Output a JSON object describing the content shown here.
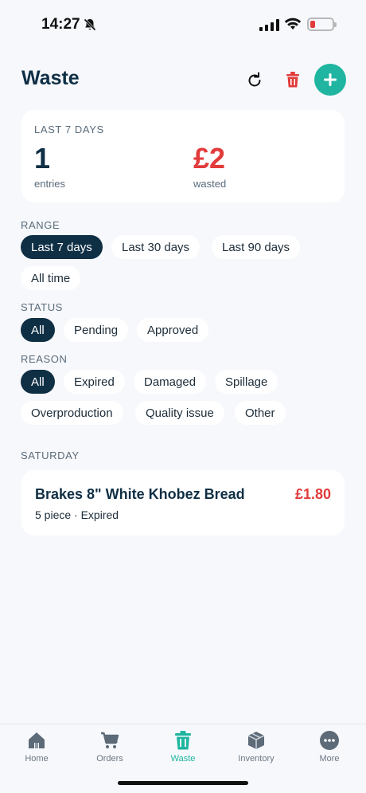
{
  "status_bar": {
    "time": "14:27"
  },
  "header": {
    "title": "Waste"
  },
  "summary": {
    "period_label": "LAST 7 DAYS",
    "entries_value": "1",
    "entries_label": "entries",
    "wasted_value": "£2",
    "wasted_label": "wasted"
  },
  "filters": {
    "range": {
      "label": "RANGE",
      "options": [
        "Last 7 days",
        "Last 30 days",
        "Last 90 days",
        "All time"
      ],
      "selected": "Last 7 days"
    },
    "status": {
      "label": "STATUS",
      "options": [
        "All",
        "Pending",
        "Approved"
      ],
      "selected": "All"
    },
    "reason": {
      "label": "REASON",
      "options": [
        "All",
        "Expired",
        "Damaged",
        "Spillage",
        "Overproduction",
        "Quality issue",
        "Other"
      ],
      "selected": "All"
    }
  },
  "groups": [
    {
      "day": "SATURDAY",
      "entries": [
        {
          "name": "Brakes 8\" White Khobez Bread",
          "amount": "£1.80",
          "meta": "5 piece · Expired"
        }
      ]
    }
  ],
  "tabs": [
    {
      "label": "Home",
      "icon": "home-icon"
    },
    {
      "label": "Orders",
      "icon": "cart-icon"
    },
    {
      "label": "Waste",
      "icon": "trash-icon",
      "active": true
    },
    {
      "label": "Inventory",
      "icon": "box-icon"
    },
    {
      "label": "More",
      "icon": "more-icon"
    }
  ],
  "colors": {
    "accent": "#1fb5a0",
    "danger": "#e23b3b",
    "primary": "#0f2f45"
  }
}
